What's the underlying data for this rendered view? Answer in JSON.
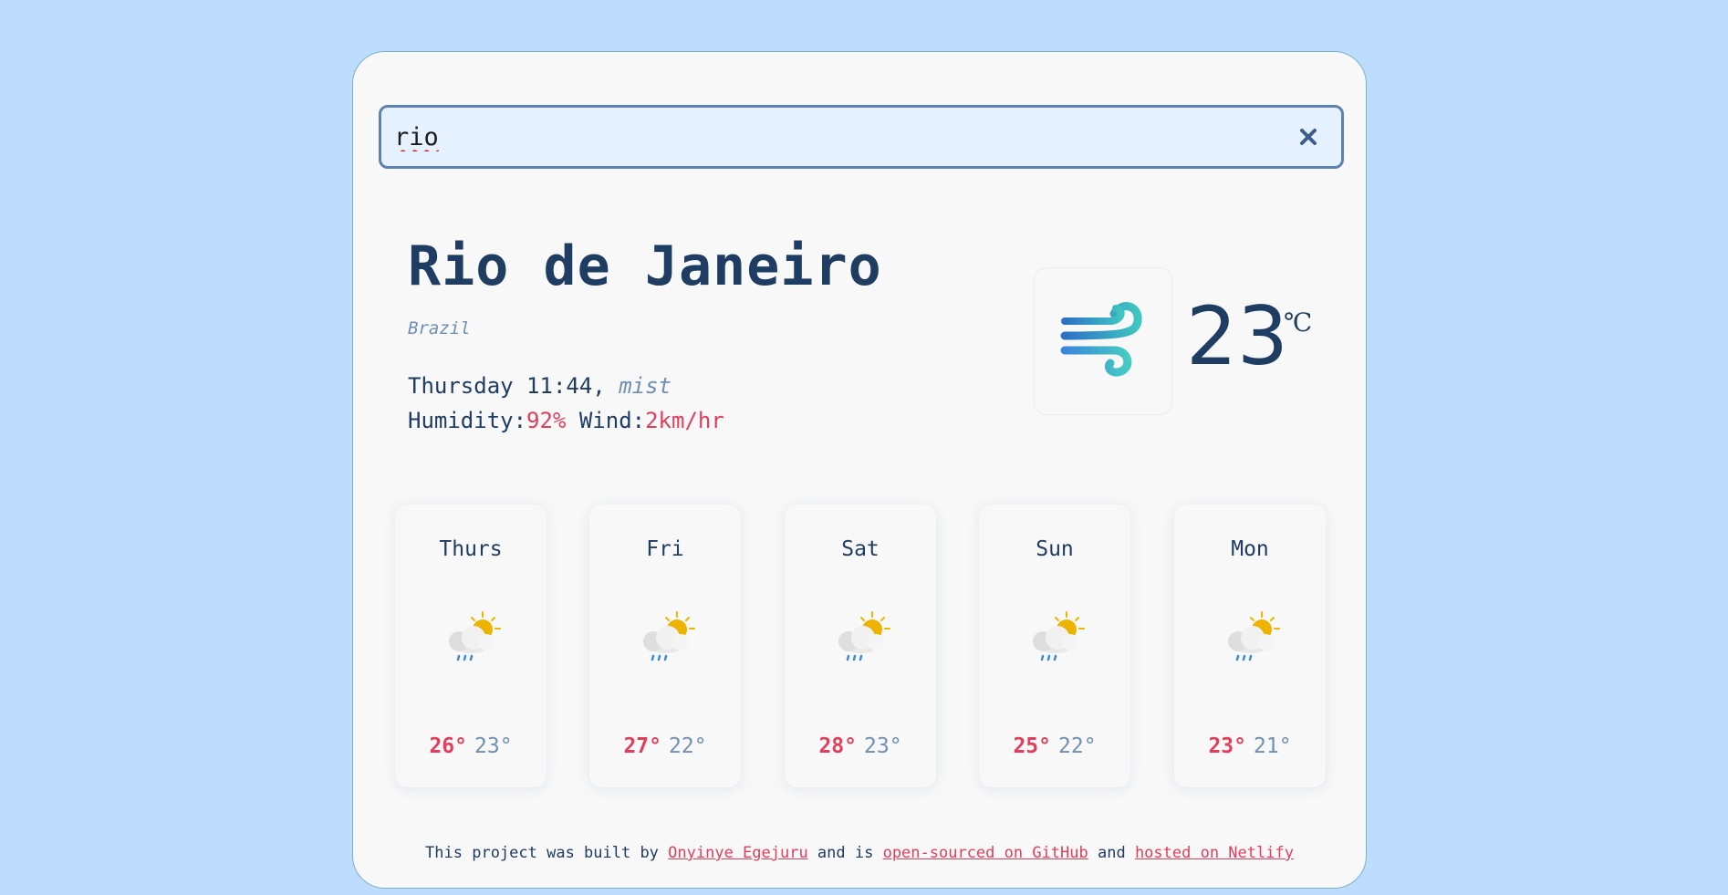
{
  "search": {
    "value": "rio",
    "placeholder": ""
  },
  "current": {
    "city": "Rio de Janeiro",
    "country": "Brazil",
    "datetime": "Thursday 11:44,",
    "description": "mist",
    "humidity_label": "Humidity:",
    "humidity_value": "92%",
    "wind_label": "Wind:",
    "wind_value": "2km/hr",
    "temperature": "23",
    "unit": "℃",
    "icon": "wind-icon"
  },
  "forecast": [
    {
      "day": "Thurs",
      "high": "26°",
      "low": "23°",
      "icon": "sun-cloud-rain-icon"
    },
    {
      "day": "Fri",
      "high": "27°",
      "low": "22°",
      "icon": "sun-cloud-rain-icon"
    },
    {
      "day": "Sat",
      "high": "28°",
      "low": "23°",
      "icon": "sun-cloud-rain-icon"
    },
    {
      "day": "Sun",
      "high": "25°",
      "low": "22°",
      "icon": "sun-cloud-rain-icon"
    },
    {
      "day": "Mon",
      "high": "23°",
      "low": "21°",
      "icon": "sun-cloud-rain-icon"
    }
  ],
  "footer": {
    "text1": "This project was built by ",
    "author": "Onyinye Egejuru",
    "text2": " and is ",
    "github": "open-sourced on GitHub",
    "text3": " and ",
    "netlify": "hosted on Netlify"
  },
  "colors": {
    "background": "#bddcfe",
    "card": "#f8f8f8",
    "primary_text": "#1f3c63",
    "muted_text": "#6f8fb3",
    "accent": "#e23e5c",
    "search_bg": "#e5f1fe",
    "search_border": "#5b82b0"
  }
}
